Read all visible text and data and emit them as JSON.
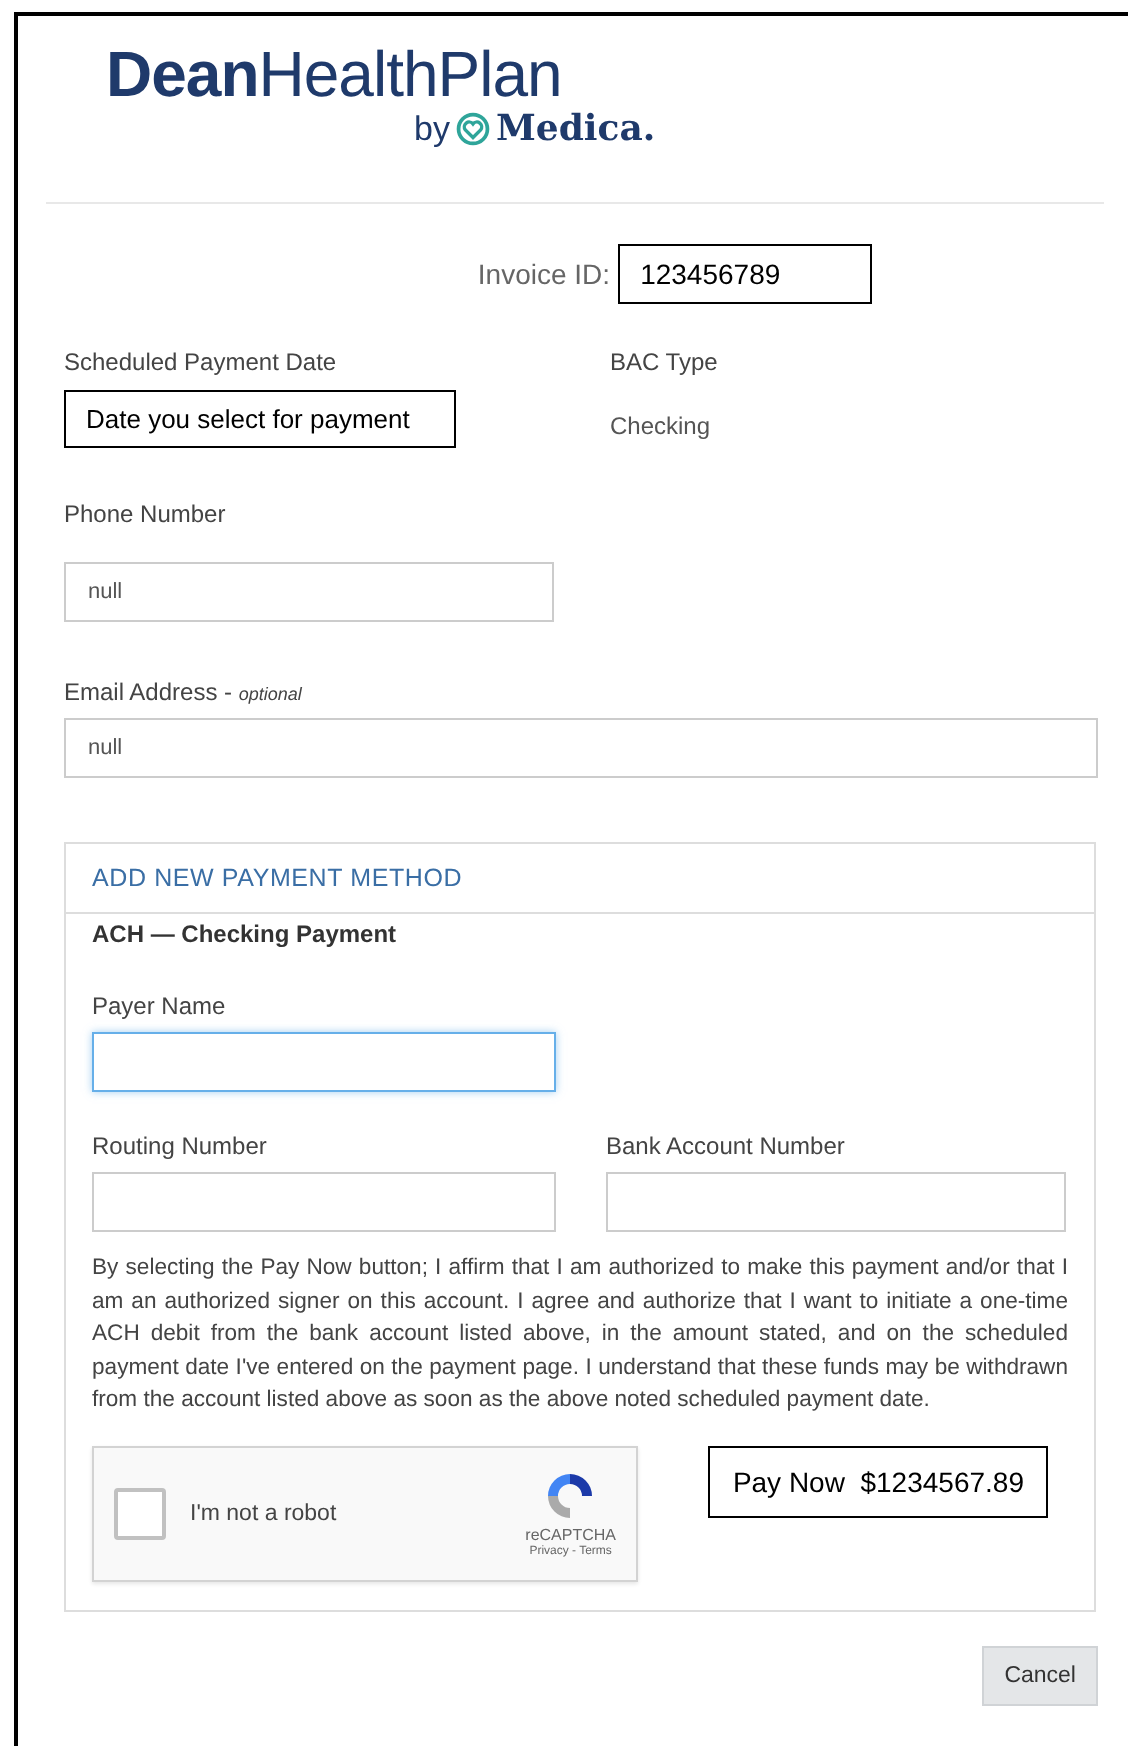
{
  "logo": {
    "wordmark": "**Dean**HealthPlan",
    "by": "by",
    "brand": "Medica."
  },
  "invoice": {
    "label": "Invoice ID:",
    "value": "123456789"
  },
  "scheduled_payment_date": {
    "label": "Scheduled Payment Date",
    "note": "Date you select for payment"
  },
  "bac_type": {
    "label": "BAC Type",
    "value": "Checking"
  },
  "phone": {
    "label": "Phone Number",
    "value": "null"
  },
  "email": {
    "label": "Email Address - ",
    "hint": "optional",
    "value": "null"
  },
  "payment_method": {
    "title": "ADD NEW PAYMENT METHOD",
    "subtitle": "ACH — Checking Payment",
    "payer_name": {
      "label": "Payer Name",
      "focused": true
    },
    "routing_number": {
      "label": "Routing Number"
    },
    "bank_account_number": {
      "label": "Bank Account Number"
    },
    "agreement": "By selecting the Pay Now button; I affirm that I am authorized to make this payment and/or that I am an authorized signer on this account. I agree and authorize that I want to initiate a one-time ACH debit from the bank account listed above, in the amount stated, and on the scheduled payment date I've entered on the payment page. I understand that these funds may be withdrawn from the account listed above as soon as the above noted scheduled payment date.",
    "captcha": {
      "label": "I'm not a robot",
      "checked": false,
      "brand": "reCAPTCHA",
      "links": "Privacy - Terms"
    },
    "pay_button": "Pay Now  $1234567.89"
  },
  "cancel_button": "Cancel"
}
